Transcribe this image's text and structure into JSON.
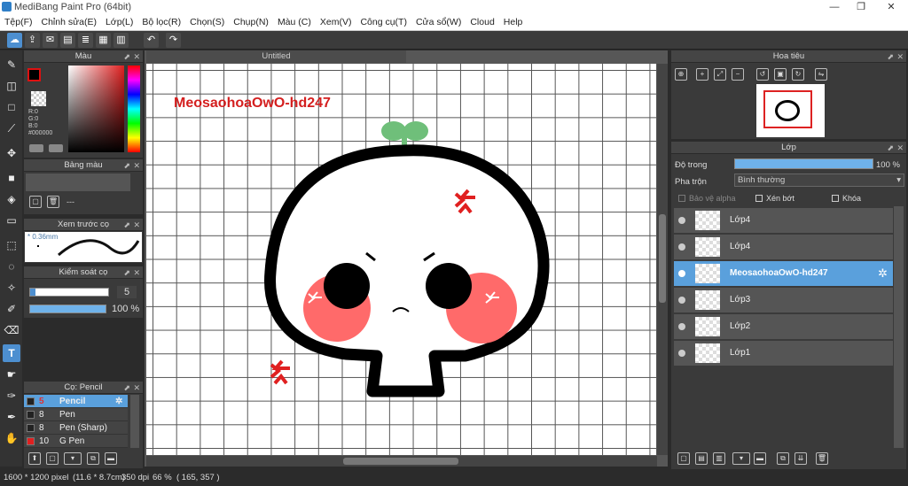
{
  "window": {
    "title": "MediBang Paint Pro (64bit)",
    "controls": {
      "minimize": "—",
      "maximize": "❐",
      "close": "✕"
    }
  },
  "menu": [
    "Tệp(F)",
    "Chỉnh sửa(E)",
    "Lớp(L)",
    "Bộ lọc(R)",
    "Chọn(S)",
    "Chụp(N)",
    "Màu (C)",
    "Xem(V)",
    "Công cụ(T)",
    "Cửa sổ(W)",
    "Cloud",
    "Help"
  ],
  "color_panel": {
    "title": "Màu",
    "r": "R:0",
    "g": "G:0",
    "b": "B:0",
    "hex": "#000000",
    "fg_color": "#000000"
  },
  "palette_panel": {
    "title": "Bảng màu",
    "value": "---"
  },
  "brush_preview": {
    "title": "Xem trước cọ",
    "size": "0.36mm"
  },
  "brush_control": {
    "title": "Kiểm soát cọ",
    "size": "5",
    "opacity": "100 %",
    "opacity_value": 1.0
  },
  "brushes_panel": {
    "title": "Cọ: Pencil",
    "items": [
      {
        "size": "5",
        "name": "Pencil",
        "selected": true,
        "color": "#222222"
      },
      {
        "size": "8",
        "name": "Pen",
        "selected": false,
        "color": "#222222"
      },
      {
        "size": "8",
        "name": "Pen (Sharp)",
        "selected": false,
        "color": "#222222"
      },
      {
        "size": "10",
        "name": "G Pen",
        "selected": false,
        "color": "#e02020"
      }
    ]
  },
  "document": {
    "tab": "Untitled",
    "text_on_canvas": "MeosaohoaOwO-hd247",
    "text_color": "#d41f1f"
  },
  "navigator": {
    "title": "Hoa tiêu"
  },
  "layers_panel": {
    "title": "Lớp",
    "opacity_label": "Độ trong",
    "opacity_value": "100 %",
    "opacity_fraction": 1.0,
    "blend_label": "Pha trộn",
    "blend_value": "Bình thường",
    "protect_alpha": "Bảo vệ alpha",
    "clipping": "Xén bớt",
    "lock": "Khóa",
    "layers": [
      {
        "name": "Lớp4",
        "selected": false
      },
      {
        "name": "Lớp4",
        "selected": false
      },
      {
        "name": "MeosaohoaOwO-hd247",
        "selected": true
      },
      {
        "name": "Lớp3",
        "selected": false
      },
      {
        "name": "Lớp2",
        "selected": false
      },
      {
        "name": "Lớp1",
        "selected": false
      }
    ]
  },
  "status": {
    "size": "1600 * 1200 pixel",
    "physical": "(11.6 * 8.7cm)",
    "dpi": "350 dpi",
    "zoom": "66 %",
    "cursor": "( 165, 357 )"
  }
}
